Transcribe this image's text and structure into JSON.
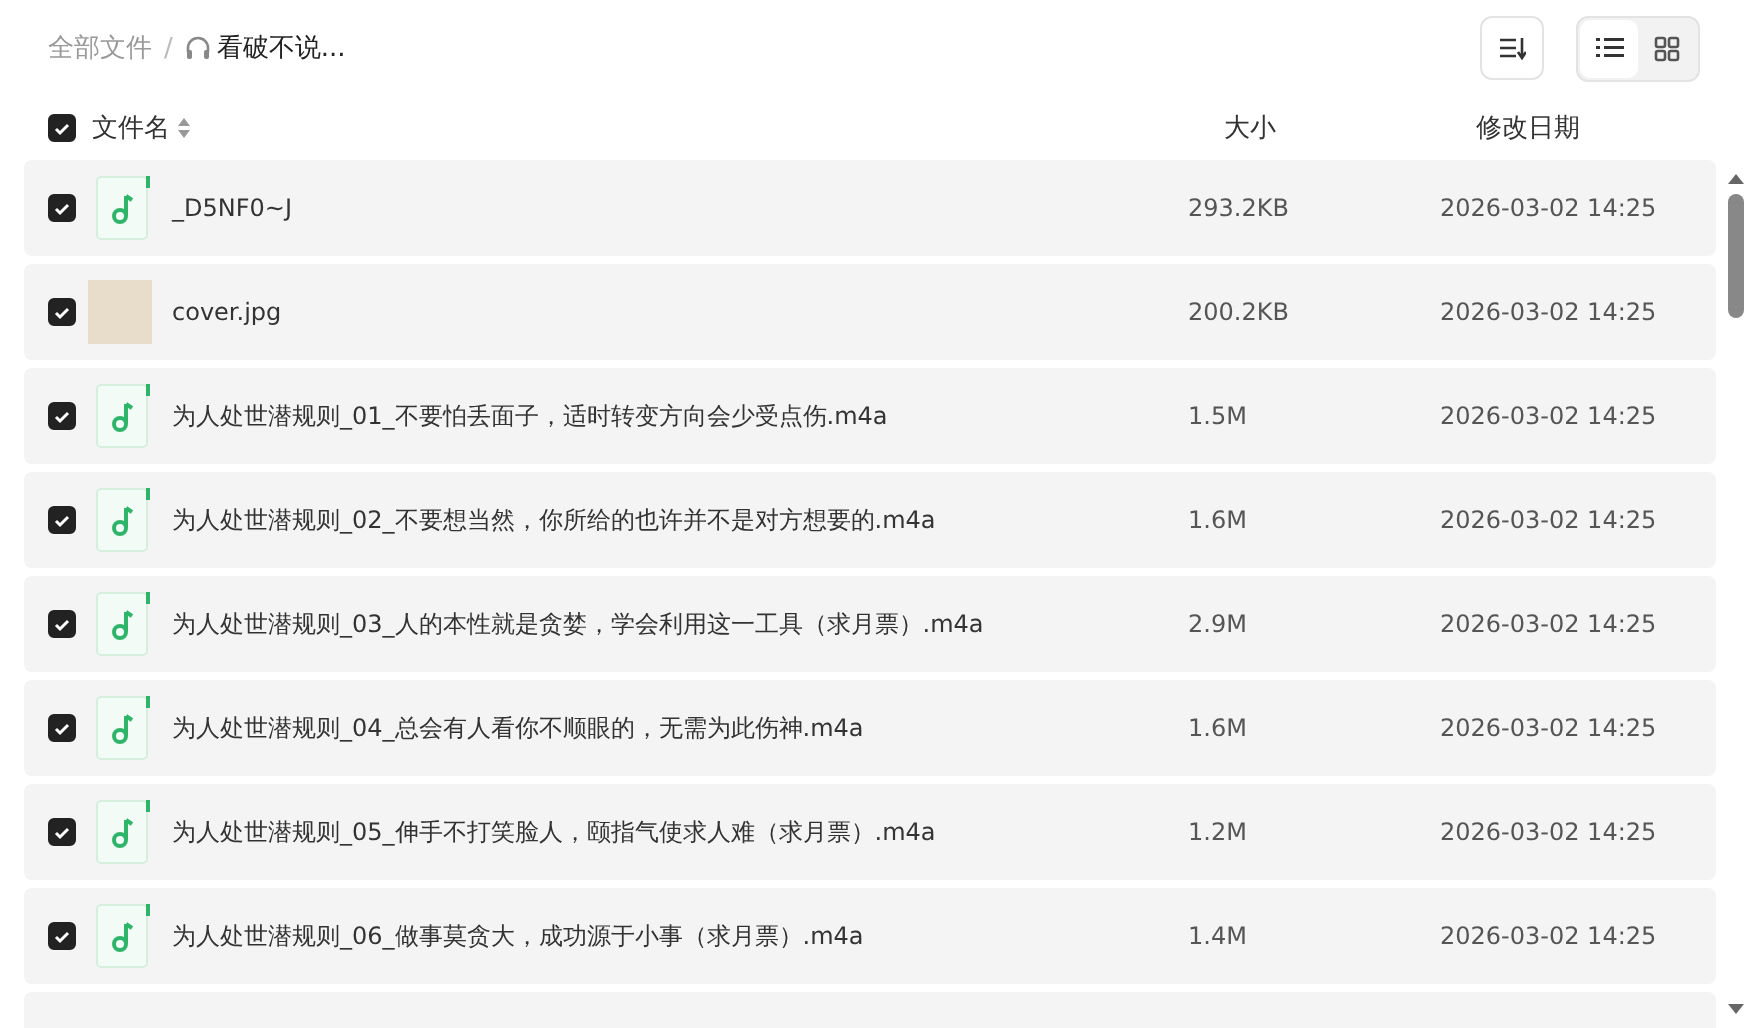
{
  "breadcrumb": {
    "root": "全部文件",
    "separator": "/",
    "current": "看破不说..."
  },
  "toolbar": {
    "views": [
      {
        "kind": "list",
        "selected": true
      },
      {
        "kind": "grid",
        "selected": false
      }
    ]
  },
  "table": {
    "select_all": {
      "checked": true
    },
    "columns": [
      "文件名",
      "大小",
      "修改日期"
    ],
    "rows": [
      {
        "kind": "audio",
        "checked": true,
        "name": "_D5NF0~J",
        "size": "293.2KB",
        "date": "2026-03-02 14:25"
      },
      {
        "kind": "image",
        "checked": true,
        "name": "cover.jpg",
        "size": "200.2KB",
        "date": "2026-03-02 14:25"
      },
      {
        "kind": "audio",
        "checked": true,
        "name": "为人处世潜规则_01_不要怕丢面子，适时转变方向会少受点伤.m4a",
        "size": "1.5M",
        "date": "2026-03-02 14:25"
      },
      {
        "kind": "audio",
        "checked": true,
        "name": "为人处世潜规则_02_不要想当然，你所给的也许并不是对方想要的.m4a",
        "size": "1.6M",
        "date": "2026-03-02 14:25"
      },
      {
        "kind": "audio",
        "checked": true,
        "name": "为人处世潜规则_03_人的本性就是贪婪，学会利用这一工具（求月票）.m4a",
        "size": "2.9M",
        "date": "2026-03-02 14:25"
      },
      {
        "kind": "audio",
        "checked": true,
        "name": "为人处世潜规则_04_总会有人看你不顺眼的，无需为此伤神.m4a",
        "size": "1.6M",
        "date": "2026-03-02 14:25"
      },
      {
        "kind": "audio",
        "checked": true,
        "name": "为人处世潜规则_05_伸手不打笑脸人，颐指气使求人难（求月票）.m4a",
        "size": "1.2M",
        "date": "2026-03-02 14:25"
      },
      {
        "kind": "audio",
        "checked": true,
        "name": "为人处世潜规则_06_做事莫贪大，成功源于小事（求月票）.m4a",
        "size": "1.4M",
        "date": "2026-03-02 14:25"
      }
    ]
  }
}
